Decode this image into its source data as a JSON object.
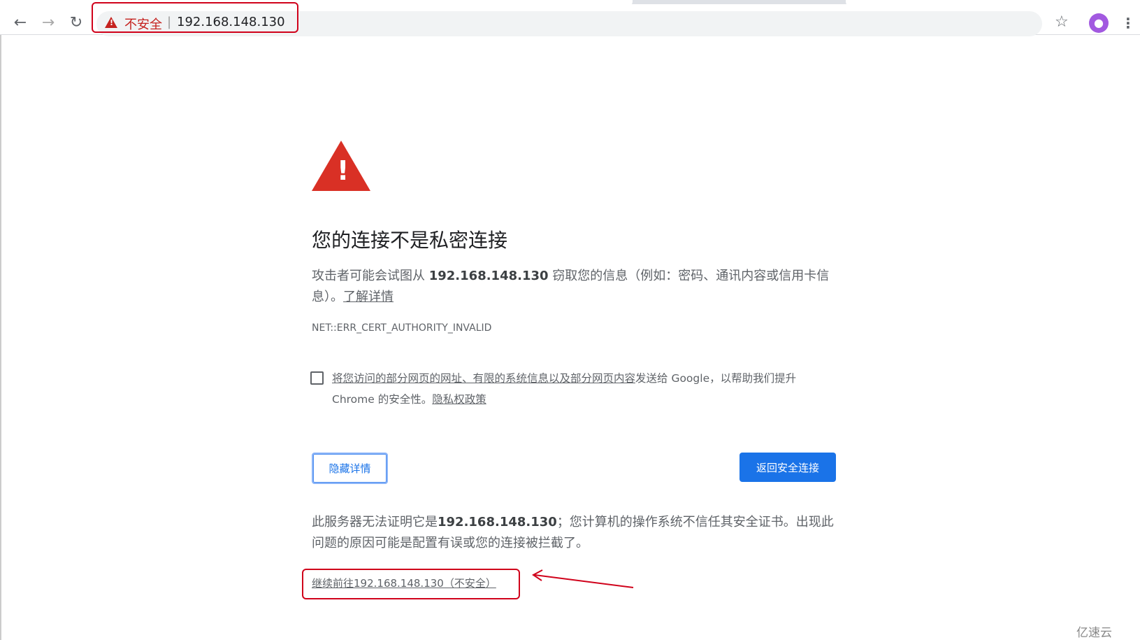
{
  "browser": {
    "back_icon": "arrow-left",
    "forward_icon": "arrow-right",
    "reload_icon": "reload",
    "security_label": "不安全",
    "url": "192.168.148.130",
    "bookmark_icon": "star-outline",
    "menu_icon": "vertical-dots"
  },
  "page": {
    "title": "您的连接不是私密连接",
    "desc_pre": "攻击者可能会试图从 ",
    "desc_host": "192.168.148.130",
    "desc_post": " 窃取您的信息（例如：密码、通讯内容或信用卡信息）。",
    "learn_more": "了解详情",
    "error_code": "NET::ERR_CERT_AUTHORITY_INVALID",
    "checkbox_link": "将您访问的部分网页的网址、有限的系统信息以及部分网页内容",
    "checkbox_text": "发送给 Google，以帮助我们提升 Chrome 的安全性。",
    "privacy_link": "隐私权政策",
    "checkbox_checked": false,
    "hide_details": "隐藏详情",
    "back_to_safety": "返回安全连接",
    "details_pre": "此服务器无法证明它是",
    "details_host": "192.168.148.130",
    "details_post": "；您计算机的操作系统不信任其安全证书。出现此问题的原因可能是配置有误或您的连接被拦截了。",
    "proceed_link": "继续前往192.168.148.130（不安全）"
  },
  "watermark": "亿速云",
  "colors": {
    "danger": "#d93025",
    "primary": "#1a73e8",
    "annotation": "#d0021b"
  }
}
